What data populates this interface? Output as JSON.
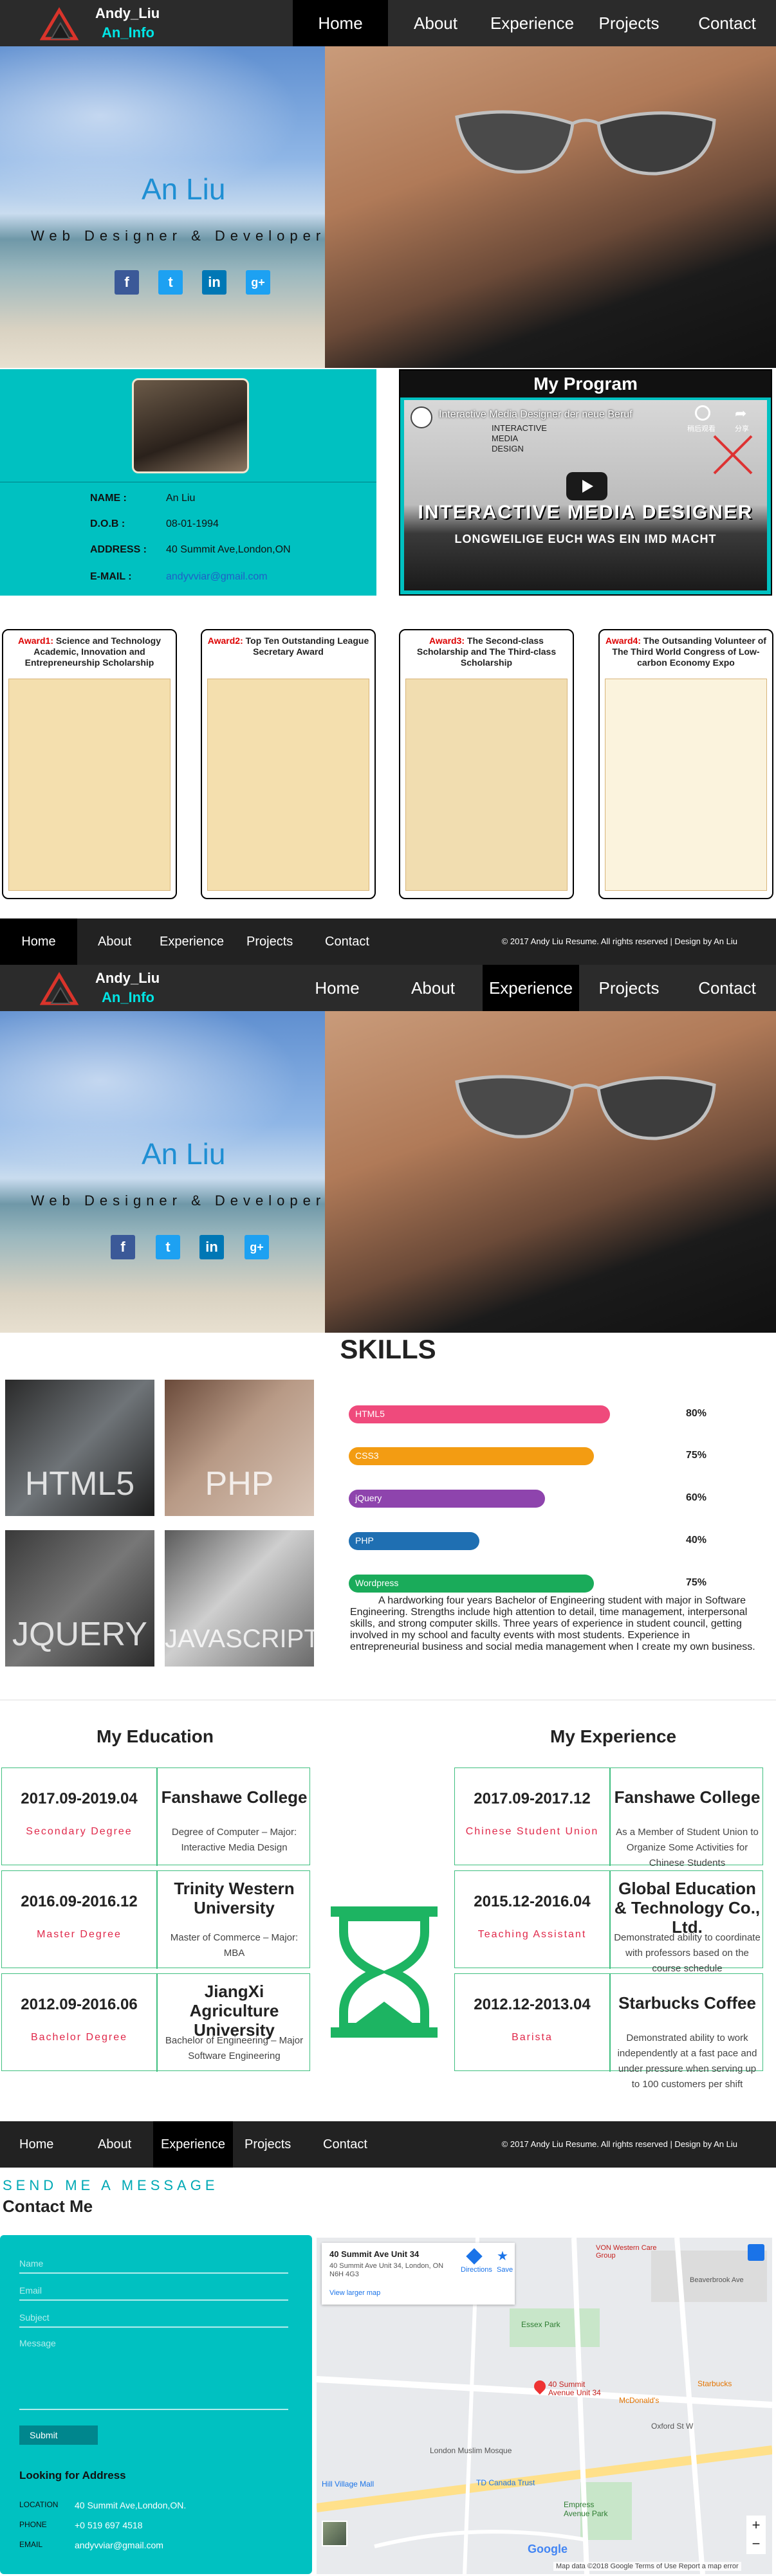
{
  "brand": {
    "name": "Andy_Liu",
    "sub": "An_Info"
  },
  "nav": {
    "home": "Home",
    "about": "About",
    "experience": "Experience",
    "projects": "Projects",
    "contact": "Contact"
  },
  "hero": {
    "name": "An Liu",
    "title": "Web Designer & Developer"
  },
  "social": {
    "f": "f",
    "t": "t",
    "in": "in",
    "g": "g+"
  },
  "profile": {
    "name_label": "NAME :",
    "name_value": "An Liu",
    "dob_label": "D.O.B :",
    "dob_value": "08-01-1994",
    "address_label": "ADDRESS :",
    "address_value": "40 Summit Ave,London,ON",
    "email_label": "E-MAIL :",
    "email_value": "andyvviar@gmail.com"
  },
  "program": {
    "title": "My Program",
    "video_title": "Interactive Media Designer der neue Beruf",
    "video_banner": "INTERACTIVE MEDIA DESIGNER",
    "video_tagline": "LONGWEILIGE EUCH WAS EIN IMD MACHT",
    "video_logo": "INTERACTIVE MEDIA DESIGN",
    "watch_later": "稍后观看",
    "share": "分享"
  },
  "awards": [
    {
      "num": "Award1:",
      "text": "Science and Technology Academic, Innovation and Entrepreneurship Scholarship"
    },
    {
      "num": "Award2:",
      "text": "Top Ten Outstanding League Secretary Award"
    },
    {
      "num": "Award3:",
      "text": "The Second-class Scholarship and The Third-class Scholarship"
    },
    {
      "num": "Award4:",
      "text": "The Outsanding Volunteer of The Third World Congress of Low-carbon Economy Expo"
    }
  ],
  "footer": {
    "copy": "© 2017 Andy Liu Resume. All rights reserved | Design by An Liu"
  },
  "skills": {
    "title": "SKILLS",
    "images": [
      "HTML5",
      "PHP",
      "JQUERY",
      "JAVASCRIPT"
    ],
    "bars": [
      {
        "name": "HTML5",
        "pct": "80%",
        "value": 0.8,
        "color": "#ef4a7c"
      },
      {
        "name": "CSS3",
        "pct": "75%",
        "value": 0.75,
        "color": "#f39c12"
      },
      {
        "name": "jQuery",
        "pct": "60%",
        "value": 0.6,
        "color": "#8e44ad"
      },
      {
        "name": "PHP",
        "pct": "40%",
        "value": 0.4,
        "color": "#1f6fb2"
      },
      {
        "name": "Wordpress",
        "pct": "75%",
        "value": 0.75,
        "color": "#1aab5a"
      }
    ],
    "summary": "A hardworking four years Bachelor of Engineering student with major in Software Engineering. Strengths include high attention to detail, time management, interpersonal skills, and strong computer skills. Three years of experience in student council, getting involved in my school and faculty events with most students. Experience in entrepreneurial business and social media management when I create my own business."
  },
  "education": {
    "title": "My Education",
    "items": [
      {
        "date": "2017.09-2019.04",
        "role": "Secondary Degree",
        "school": "Fanshawe College",
        "desc": "Degree of Computer – Major: Interactive Media Design"
      },
      {
        "date": "2016.09-2016.12",
        "role": "Master Degree",
        "school": "Trinity Western University",
        "desc": "Master of Commerce – Major: MBA"
      },
      {
        "date": "2012.09-2016.06",
        "role": "Bachelor Degree",
        "school": "JiangXi Agriculture University",
        "desc": "Bachelor of Engineering – Major Software Engineering"
      }
    ]
  },
  "experience": {
    "title": "My Experience",
    "items": [
      {
        "date": "2017.09-2017.12",
        "role": "Chinese Student Union",
        "company": "Fanshawe College",
        "desc": "As a Member of Student Union to Organize Some Activities for Chinese Students"
      },
      {
        "date": "2015.12-2016.04",
        "role": "Teaching Assistant",
        "company": "Global Education & Technology Co., Ltd.",
        "desc": "Demonstrated ability to coordinate with professors based on the course schedule"
      },
      {
        "date": "2012.12-2013.04",
        "role": "Barista",
        "company": "Starbucks Coffee",
        "desc": "Demonstrated ability to work independently at a fast pace and under pressure when serving up to 100 customers per shift"
      }
    ]
  },
  "contact": {
    "kicker": "SEND ME A MESSAGE",
    "title": "Contact Me",
    "fields": [
      "Name",
      "Email",
      "Subject",
      "Message"
    ],
    "submit": "Submit",
    "lookup": "Looking for Address",
    "location_label": "LOCATION",
    "location_value": "40 Summit Ave,London,ON.",
    "phone_label": "PHONE",
    "phone_value": "+0 519 697 4518",
    "email_label": "EMAIL",
    "email_value": "andyvviar@gmail.com"
  },
  "map": {
    "place": "40 Summit Ave Unit 34",
    "address": "40 Summit Ave Unit 34, London, ON N6H 4G3",
    "larger": "View larger map",
    "directions": "Directions",
    "save": "Save",
    "pin": "40 Summit Avenue Unit 34",
    "labels": [
      "Essex Park",
      "London Muslim Mosque",
      "TD Canada Trust",
      "Oxford St W",
      "Empress Avenue Park",
      "McDonald's",
      "Starbucks",
      "Hill Village Mall",
      "Beaverbrook Ave",
      "VON Western Care Group"
    ],
    "footer": "Map data ©2018 Google   Terms of Use   Report a map error",
    "google": "Google"
  }
}
